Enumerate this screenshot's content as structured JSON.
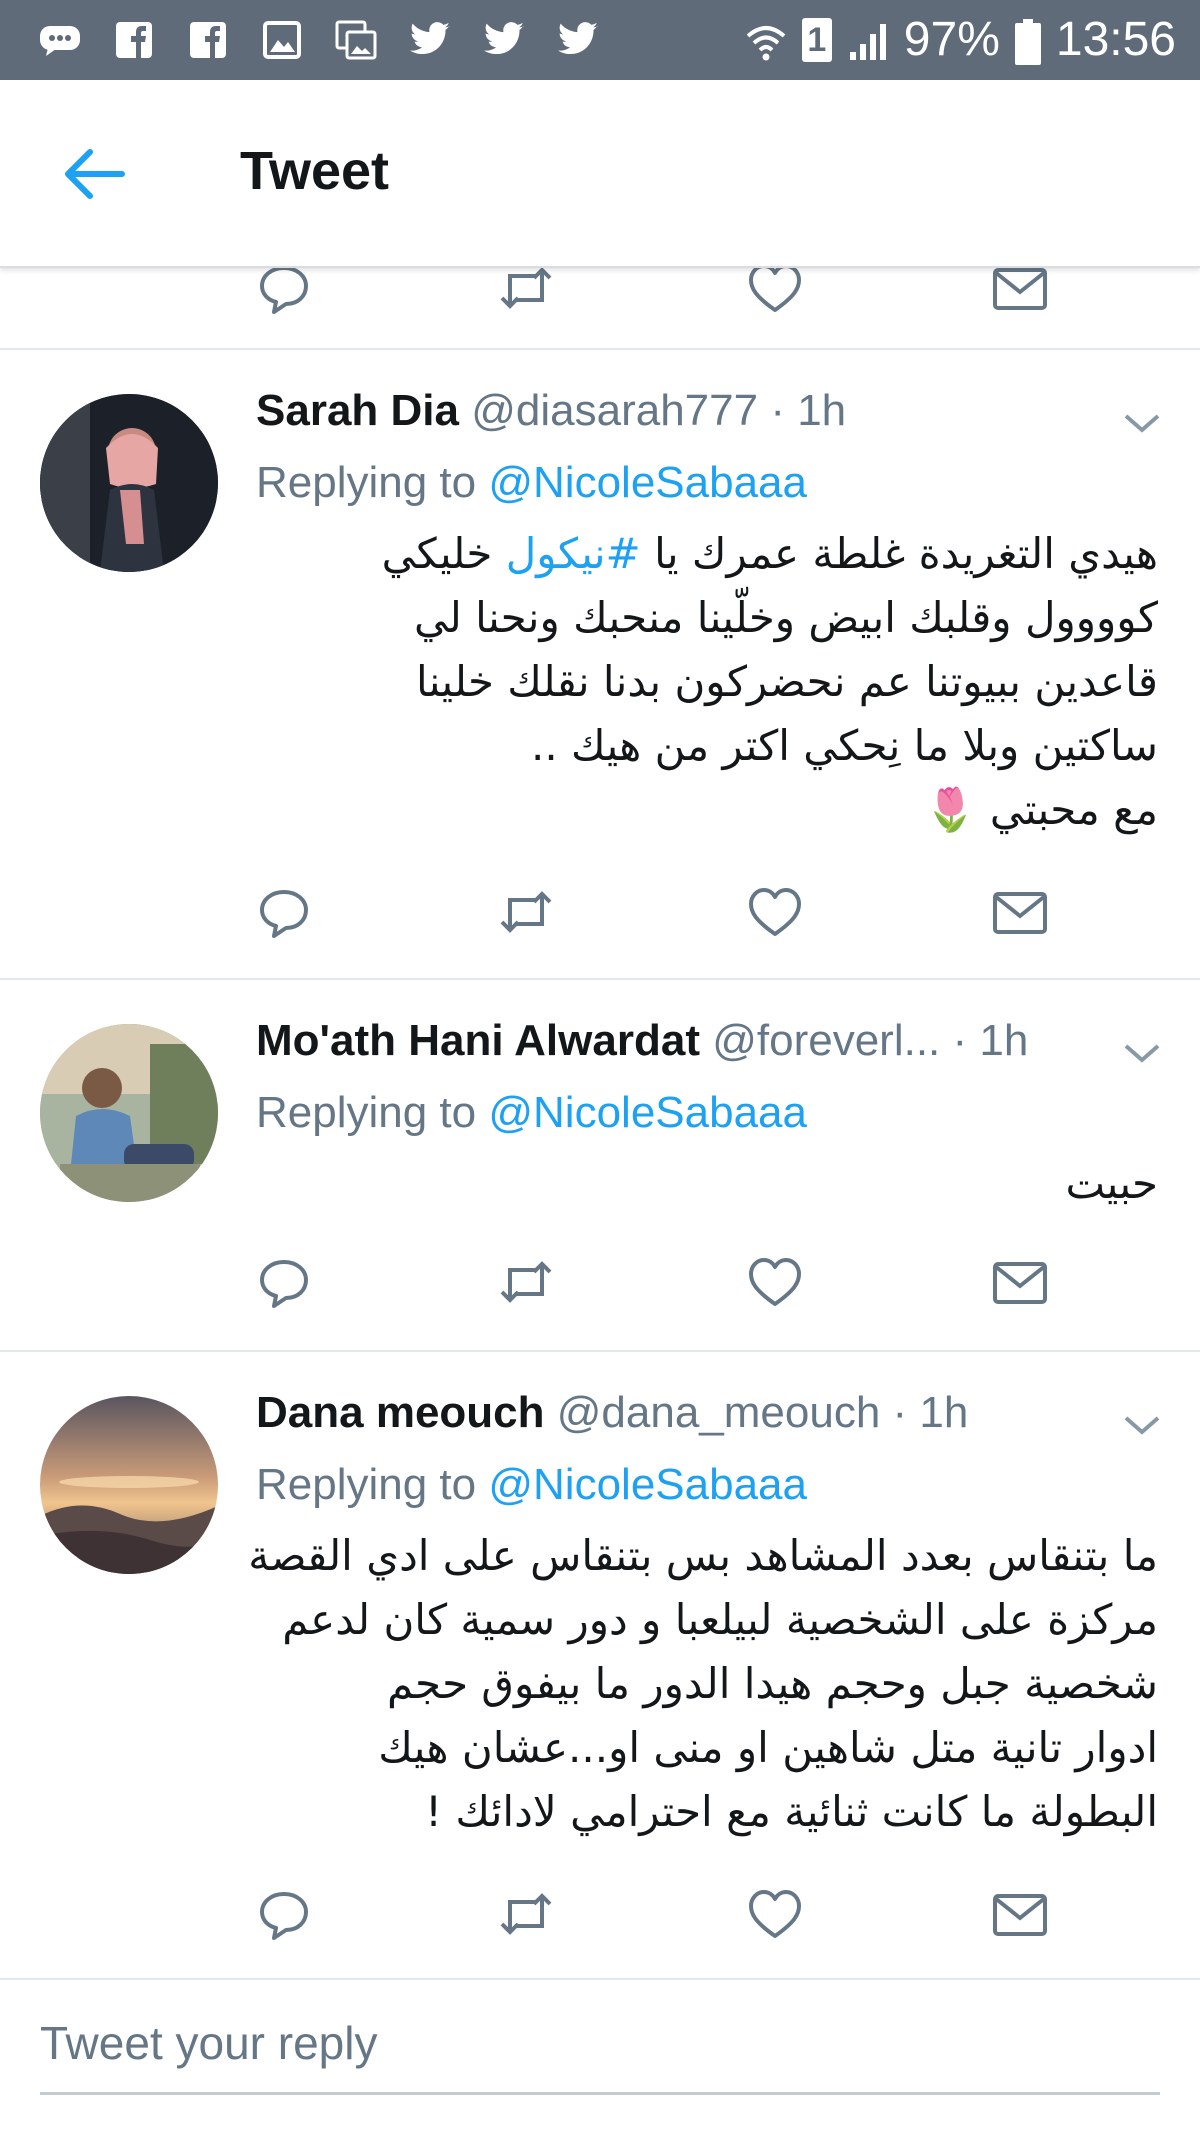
{
  "status_bar": {
    "battery": "97%",
    "time": "13:56",
    "sim_slot": "1",
    "notification_icons": [
      "chat-icon",
      "facebook-icon",
      "facebook-icon",
      "gallery-icon",
      "gallery-icon",
      "twitter-icon",
      "twitter-icon",
      "twitter-icon"
    ]
  },
  "header": {
    "title": "Tweet",
    "back_icon": "back-arrow-icon"
  },
  "tweets": [
    {
      "name": "Sarah Dia",
      "handle": "@diasarah777",
      "time": "· 1h",
      "replying_prefix": "Replying to ",
      "replying_to": "@NicoleSabaaa",
      "body_lines": [
        {
          "before": "هيدي التغريدة غلطة عمرك يا ",
          "hashtag": "#نيكول",
          "after": " خليكي"
        },
        {
          "before": "كوووول وقلبك ابيض وخلّينا منحبك  ونحنا لي",
          "hashtag": "",
          "after": ""
        },
        {
          "before": "قاعدين ببيوتنا عم نحضركون بدنا نقلك خلينا",
          "hashtag": "",
          "after": ""
        },
        {
          "before": "ساكتين وبلا ما نِحكي اكتر من هيك ..",
          "hashtag": "",
          "after": ""
        },
        {
          "before": "مع محبتي 🌷",
          "hashtag": "",
          "after": ""
        }
      ]
    },
    {
      "name": "Mo'ath Hani Alwardat",
      "handle": "@foreverl...",
      "time": "· 1h",
      "replying_prefix": "Replying to ",
      "replying_to": "@NicoleSabaaa",
      "body_lines": [
        {
          "before": "حبيت",
          "hashtag": "",
          "after": ""
        }
      ]
    },
    {
      "name": "Dana meouch",
      "handle": "@dana_meouch",
      "time": "· 1h",
      "replying_prefix": "Replying to ",
      "replying_to": "@NicoleSabaaa",
      "body_lines": [
        {
          "before": "ما بتنقاس بعدد المشاهد بس بتنقاس على ادي القصة",
          "hashtag": "",
          "after": ""
        },
        {
          "before": "مركزة على الشخصية لبيلعبا و دور سمية كان لدعم",
          "hashtag": "",
          "after": ""
        },
        {
          "before": "شخصية جبل وحجم هيدا الدور ما بيفوق حجم",
          "hashtag": "",
          "after": ""
        },
        {
          "before": "ادوار تانية متل شاهين او منى او...عشان هيك",
          "hashtag": "",
          "after": ""
        },
        {
          "before": "البطولة ما كانت ثنائية مع احترامي لادائك !",
          "hashtag": "",
          "after": ""
        }
      ]
    }
  ],
  "action_icons": [
    "reply-icon",
    "retweet-icon",
    "like-icon",
    "message-icon"
  ],
  "composer": {
    "placeholder": "Tweet your reply"
  },
  "colors": {
    "accent": "#1da1f2",
    "secondary_text": "#657786",
    "status_bar": "#5f6b78"
  }
}
